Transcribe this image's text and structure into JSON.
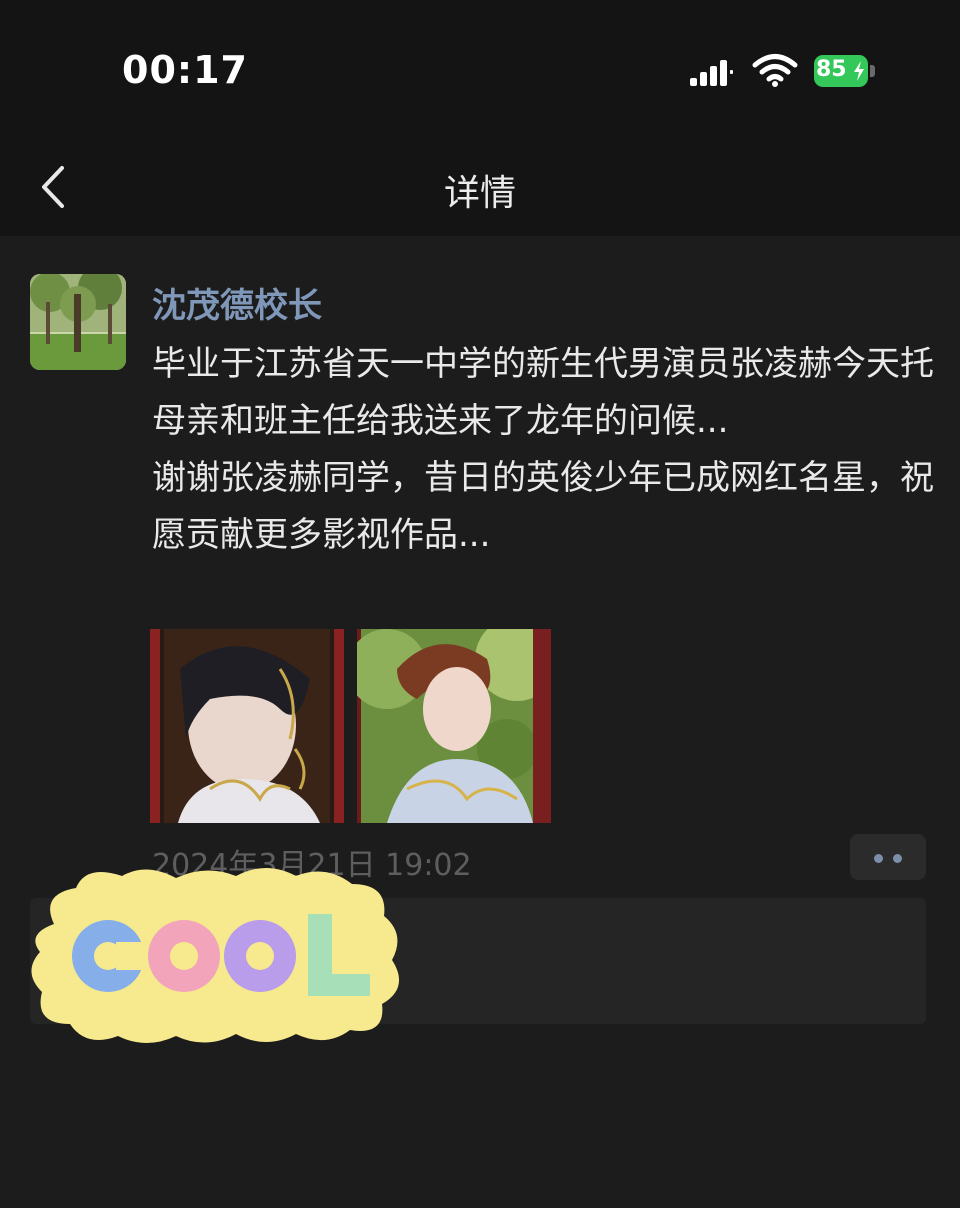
{
  "status_bar": {
    "time": "00:17",
    "battery": "85"
  },
  "nav": {
    "title": "详情"
  },
  "post": {
    "author": "沈茂德校长",
    "paragraphs": [
      "毕业于江苏省天一中学的新生代男演员张凌赫今天托母亲和班主任给我送来了龙年的问候...",
      "谢谢张凌赫同学，昔日的英俊少年已成网红名星，祝愿贡献更多影视作品..."
    ],
    "time": "2024年3月21日 19:02"
  },
  "sticker": {
    "text": "COOL"
  },
  "colors": {
    "background": "#1c1c1c",
    "bar": "#141414",
    "author_link": "#7f97b8",
    "battery": "#34c759",
    "sticker_blob": "#f7ea8e"
  },
  "icons": [
    "signal-icon",
    "wifi-icon",
    "battery-icon",
    "back-arrow-icon",
    "more-dots-icon"
  ]
}
